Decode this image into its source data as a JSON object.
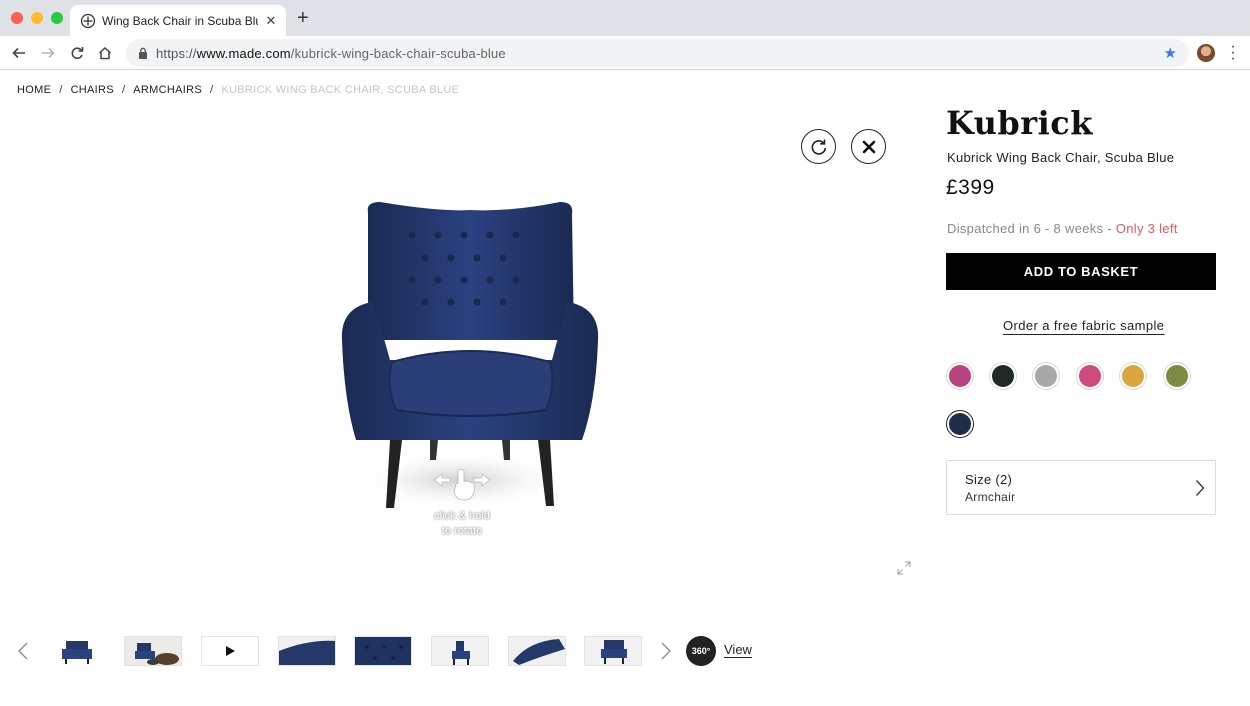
{
  "browser": {
    "tab_title": "Wing Back Chair in Scuba Blue",
    "url_scheme": "https://",
    "url_domain": "www.made.com",
    "url_path": "/kubrick-wing-back-chair-scuba-blue",
    "tab_close": "✕",
    "new_tab": "+"
  },
  "breadcrumb": {
    "items": [
      "HOME",
      "CHAIRS",
      "ARMCHAIRS"
    ],
    "separator": "/",
    "current": "KUBRICK WING BACK CHAIR, SCUBA BLUE"
  },
  "viewer": {
    "hint_line1": "click & hold",
    "hint_line2": "to rotate",
    "view_360_label": "360°",
    "view_link": "View"
  },
  "product": {
    "name": "Kubrick",
    "subtitle": "Kubrick Wing Back Chair, Scuba Blue",
    "price": "£399",
    "dispatch": "Dispatched in 6 - 8 weeks - ",
    "stock": "Only 3 left",
    "add_to_basket": "ADD TO BASKET",
    "fabric_sample": "Order a free fabric sample",
    "size_title": "Size (2)",
    "size_value": "Armchair"
  },
  "swatches": [
    {
      "name": "magenta",
      "color": "#b8417f"
    },
    {
      "name": "dark-green",
      "color": "#1f2a25"
    },
    {
      "name": "grey",
      "color": "#a8a8a8"
    },
    {
      "name": "pink",
      "color": "#cf4a7d"
    },
    {
      "name": "mustard",
      "color": "#d9a53f"
    },
    {
      "name": "olive",
      "color": "#7a8c44"
    },
    {
      "name": "scuba-blue",
      "color": "#1f2e48",
      "selected": true
    }
  ],
  "colors": {
    "accent_stock": "#e05a5a",
    "button_bg": "#000000",
    "chair_blue": "#24386a"
  }
}
